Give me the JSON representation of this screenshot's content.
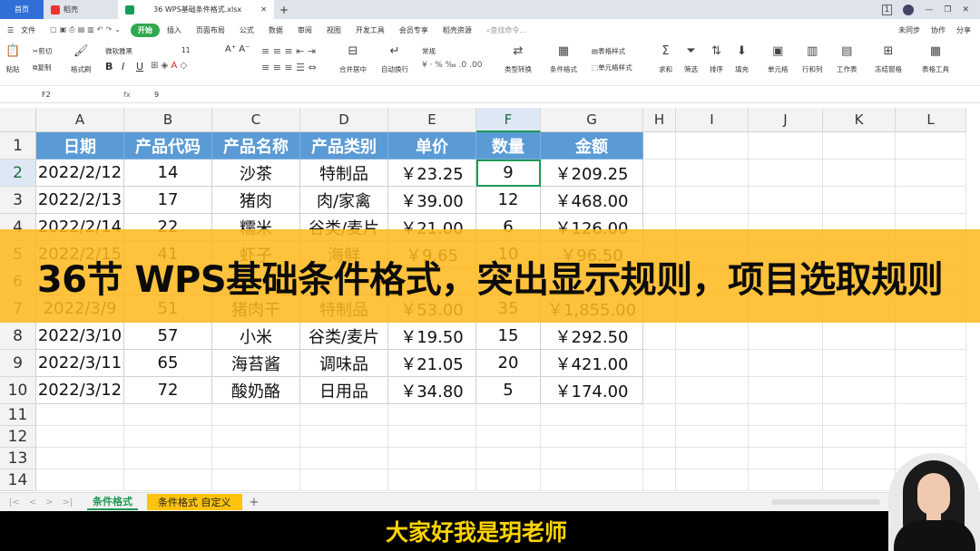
{
  "titlebar": {
    "home_tab": "首页",
    "wps_tab": "稻壳",
    "file_tab": "36 WPS基础条件格式.xlsx",
    "add_tab": "+",
    "win_badge": "1"
  },
  "menu": {
    "file": "文件",
    "items": [
      "开始",
      "插入",
      "页面布局",
      "公式",
      "数据",
      "审阅",
      "视图",
      "开发工具",
      "会员专享",
      "稻壳资源"
    ],
    "search": "查找命令...",
    "right": [
      "未同步",
      "协作",
      "分享"
    ]
  },
  "toolbar": {
    "paste": "粘贴",
    "cut": "剪切",
    "copy": "复制",
    "format_painter": "格式刷",
    "font_name": "微软雅黑",
    "font_size": "11",
    "bold": "B",
    "italic": "I",
    "underline": "U",
    "merge": "合并居中",
    "wrap": "自动换行",
    "number_format": "常规",
    "convert": "类型转换",
    "cond_format": "条件格式",
    "table_style": "表格样式",
    "cell_style": "单元格样式",
    "sum": "求和",
    "filter": "筛选",
    "sort": "排序",
    "fill": "填充",
    "cell": "单元格",
    "rowcol": "行和列",
    "worksheet": "工作表",
    "freeze": "冻结窗格",
    "table_tools": "表格工具"
  },
  "formula": {
    "cell_ref": "F2",
    "fx": "fx",
    "value": "9"
  },
  "sheet": {
    "columns": [
      "A",
      "B",
      "C",
      "D",
      "E",
      "F",
      "G",
      "H",
      "I",
      "J",
      "K",
      "L"
    ],
    "selected_column": "F",
    "rows": [
      "1",
      "2",
      "3",
      "4",
      "5",
      "6",
      "7",
      "8",
      "9",
      "10",
      "11",
      "12",
      "13",
      "14"
    ],
    "selected_row": "2",
    "headers": [
      "日期",
      "产品代码",
      "产品名称",
      "产品类别",
      "单价",
      "数量",
      "金额"
    ],
    "data": [
      [
        "2022/2/12",
        "14",
        "沙茶",
        "特制品",
        "￥23.25",
        "9",
        "￥209.25"
      ],
      [
        "2022/2/13",
        "17",
        "猪肉",
        "肉/家禽",
        "￥39.00",
        "12",
        "￥468.00"
      ],
      [
        "2022/2/14",
        "22",
        "糯米",
        "谷类/麦片",
        "￥21.00",
        "6",
        "￥126.00"
      ],
      [
        "2022/2/15",
        "41",
        "虾子",
        "海鲜",
        "￥9.65",
        "10",
        "￥96.50"
      ],
      [
        "",
        "",
        "",
        "",
        "",
        "",
        ""
      ],
      [
        "2022/3/9",
        "51",
        "猪肉干",
        "特制品",
        "￥53.00",
        "35",
        "￥1,855.00"
      ],
      [
        "2022/3/10",
        "57",
        "小米",
        "谷类/麦片",
        "￥19.50",
        "15",
        "￥292.50"
      ],
      [
        "2022/3/11",
        "65",
        "海苔酱",
        "调味品",
        "￥21.05",
        "20",
        "￥421.00"
      ],
      [
        "2022/3/12",
        "72",
        "酸奶酪",
        "日用品",
        "￥34.80",
        "5",
        "￥174.00"
      ]
    ]
  },
  "banner": {
    "text": "36节 WPS基础条件格式，突出显示规则，项目选取规则"
  },
  "sheet_tabs": {
    "tab1": "条件格式",
    "tab2": "条件格式 自定义",
    "add": "+"
  },
  "subtitle": "大家好我是玥老师",
  "colors": {
    "header_fill": "#5b9bd5",
    "banner": "#ffb81c",
    "active_green": "#1f9954",
    "subtitle": "#ffd400"
  }
}
